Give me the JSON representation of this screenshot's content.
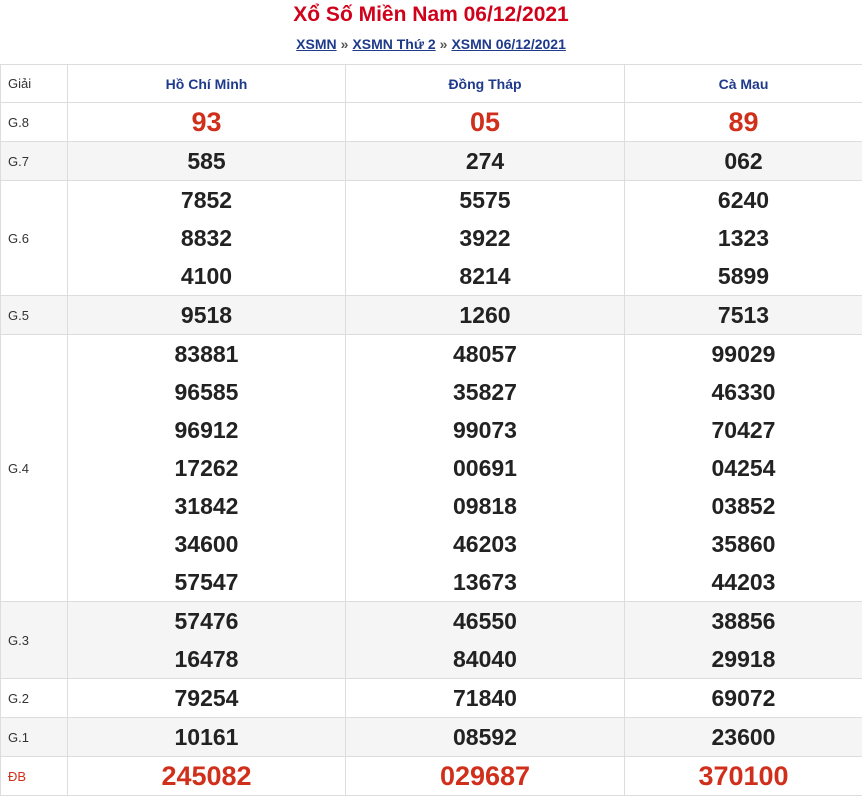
{
  "header": {
    "title": "Xổ Số Miền Nam 06/12/2021",
    "breadcrumb": [
      "XSMN",
      "XSMN Thứ 2",
      "XSMN 06/12/2021"
    ],
    "separator": "»"
  },
  "table": {
    "label_header": "Giải",
    "provinces": [
      "Hồ Chí Minh",
      "Đồng Tháp",
      "Cà Mau"
    ],
    "prizes": [
      {
        "label": "G.8",
        "alt": false,
        "red": true,
        "values": [
          [
            "93"
          ],
          [
            "05"
          ],
          [
            "89"
          ]
        ]
      },
      {
        "label": "G.7",
        "alt": true,
        "red": false,
        "values": [
          [
            "585"
          ],
          [
            "274"
          ],
          [
            "062"
          ]
        ]
      },
      {
        "label": "G.6",
        "alt": false,
        "red": false,
        "values": [
          [
            "7852",
            "8832",
            "4100"
          ],
          [
            "5575",
            "3922",
            "8214"
          ],
          [
            "6240",
            "1323",
            "5899"
          ]
        ]
      },
      {
        "label": "G.5",
        "alt": true,
        "red": false,
        "values": [
          [
            "9518"
          ],
          [
            "1260"
          ],
          [
            "7513"
          ]
        ]
      },
      {
        "label": "G.4",
        "alt": false,
        "red": false,
        "values": [
          [
            "83881",
            "96585",
            "96912",
            "17262",
            "31842",
            "34600",
            "57547"
          ],
          [
            "48057",
            "35827",
            "99073",
            "00691",
            "09818",
            "46203",
            "13673"
          ],
          [
            "99029",
            "46330",
            "70427",
            "04254",
            "03852",
            "35860",
            "44203"
          ]
        ]
      },
      {
        "label": "G.3",
        "alt": true,
        "red": false,
        "values": [
          [
            "57476",
            "16478"
          ],
          [
            "46550",
            "84040"
          ],
          [
            "38856",
            "29918"
          ]
        ]
      },
      {
        "label": "G.2",
        "alt": false,
        "red": false,
        "values": [
          [
            "79254"
          ],
          [
            "71840"
          ],
          [
            "69072"
          ]
        ]
      },
      {
        "label": "G.1",
        "alt": true,
        "red": false,
        "values": [
          [
            "10161"
          ],
          [
            "08592"
          ],
          [
            "23600"
          ]
        ]
      },
      {
        "label": "ĐB",
        "alt": false,
        "red": true,
        "values": [
          [
            "245082"
          ],
          [
            "029687"
          ],
          [
            "370100"
          ]
        ]
      }
    ]
  },
  "colors": {
    "title": "#d0021b",
    "link": "#1f3a8a",
    "special": "#d0301b"
  }
}
